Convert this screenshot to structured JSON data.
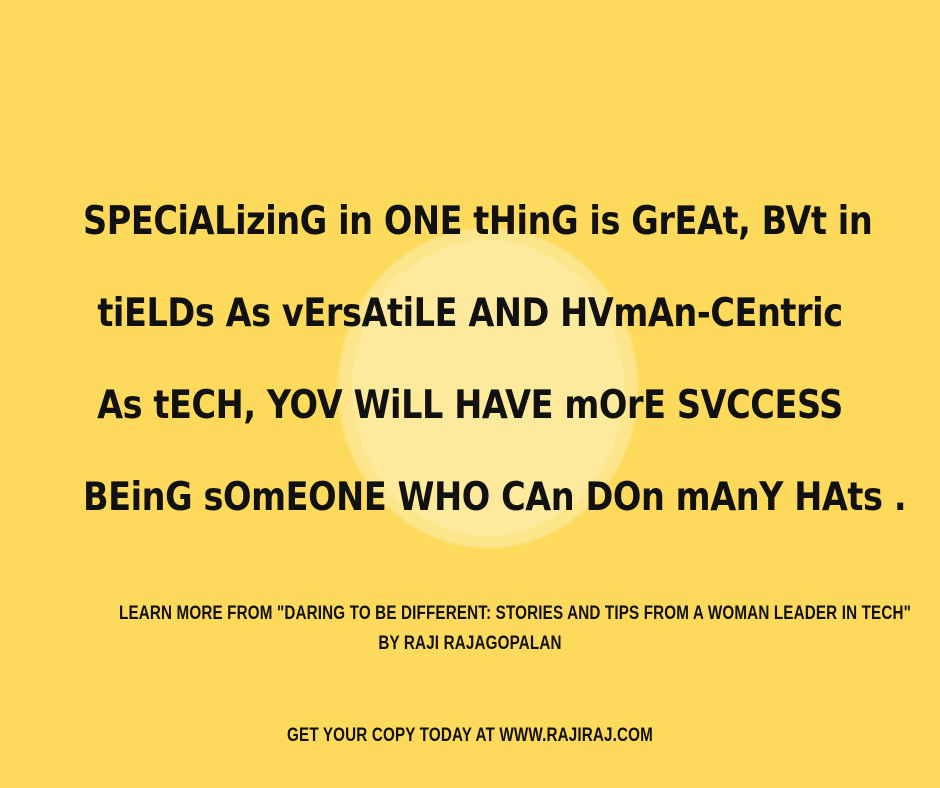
{
  "quote": {
    "lines": [
      "SPECiALizinG in ONE tHinG is GrEAt, BVt in",
      "tiELDs As vErsAtiLE AND HVmAn-CEntric",
      "As tECH, YOV WiLL HAVE mOrE SVCCESS",
      "BEinG sOmEONE WHO CAn DOn mAnY HAts ."
    ]
  },
  "footer": {
    "learn_more_line1": "LEARN MORE FROM \"DARING TO BE DIFFERENT: STORIES AND TIPS FROM A WOMAN LEADER IN TECH\"",
    "learn_more_line2": "BY RAJI RAJAGOPALAN",
    "cta": "GET YOUR COPY TODAY AT WWW.RAJIRAJ.COM"
  },
  "colors": {
    "background": "#fdd95c",
    "circle": "#fee68e",
    "text": "#111111"
  }
}
